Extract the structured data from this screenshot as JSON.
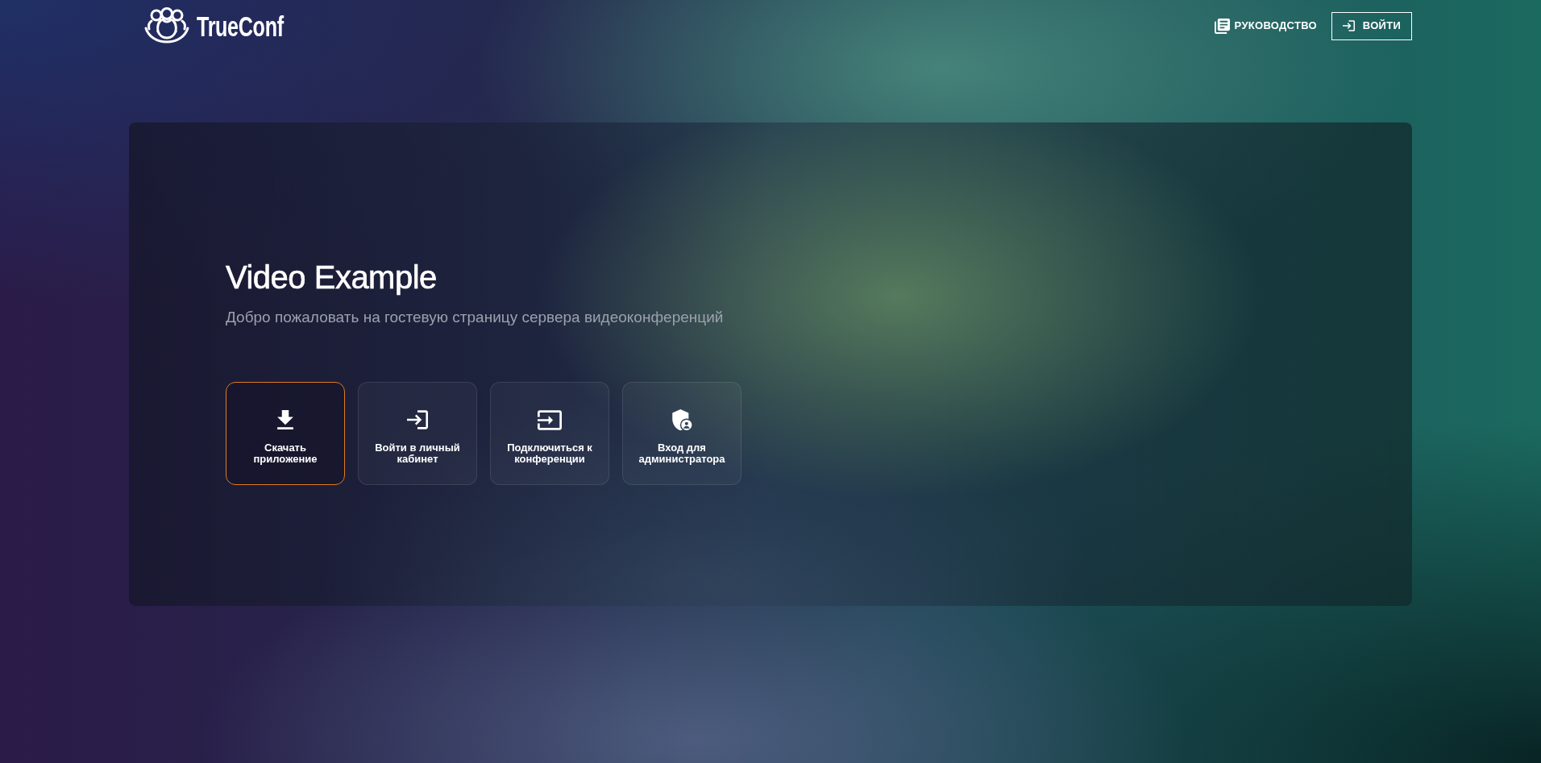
{
  "header": {
    "logo_text": "TrueConf",
    "links": [
      {
        "kind": "guide",
        "label": "РУКОВОДСТВО"
      },
      {
        "kind": "login",
        "label": "ВОЙТИ"
      }
    ]
  },
  "hero": {
    "title": "Video Example",
    "subtitle": "Добро пожаловать на гостевую страницу сервера видеоконференций"
  },
  "actions": [
    {
      "kind": "download",
      "label": "Скачать приложение",
      "selected": true
    },
    {
      "kind": "login",
      "label": "Войти в личный кабинет",
      "selected": false
    },
    {
      "kind": "join",
      "label": "Подключиться к конференции",
      "selected": false
    },
    {
      "kind": "admin",
      "label": "Вход для администратора",
      "selected": false
    }
  ]
}
